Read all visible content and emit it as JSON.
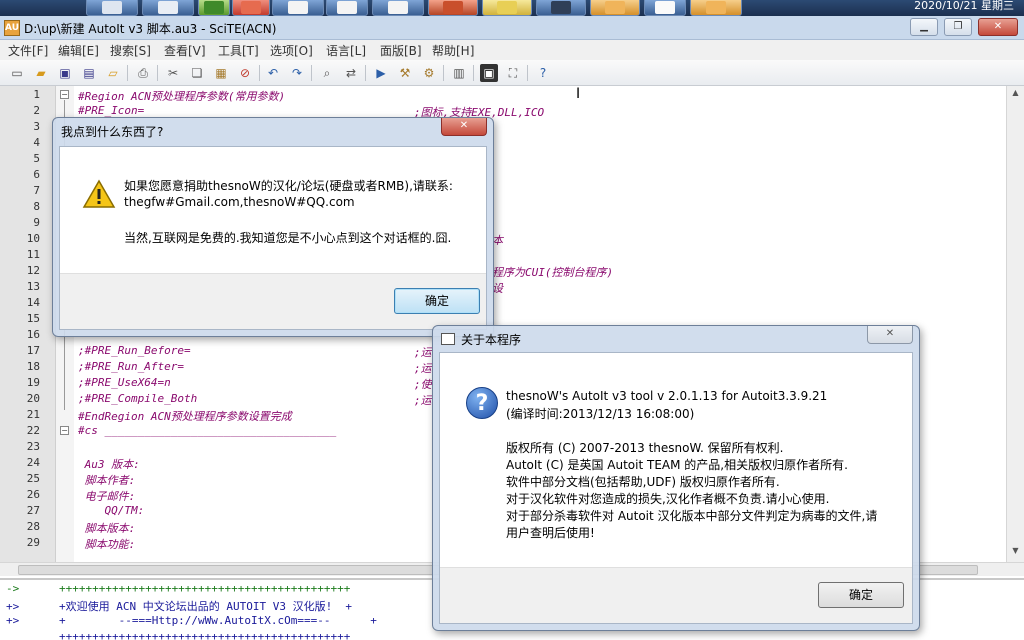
{
  "taskbar": {
    "clock_text": "2020/10/21 星期三"
  },
  "window": {
    "title": "D:\\up\\新建 AutoIt v3 脚本.au3 - SciTE(ACN)",
    "app_icon_label": "AU",
    "minimize_icon": "minimize-icon",
    "restore_icon": "restore-icon",
    "close_icon": "close-icon"
  },
  "menu": {
    "items": [
      "文件[F]",
      "编辑[E]",
      "搜索[S]",
      "查看[V]",
      "工具[T]",
      "选项[O]",
      "语言[L]",
      "面版[B]",
      "帮助[H]"
    ]
  },
  "toolbar": {
    "icons": [
      "new-file-icon",
      "open-icon",
      "save-icon",
      "save-all-icon",
      "open-folder-icon",
      "print-icon",
      "cut-icon",
      "copy-icon",
      "paste-icon",
      "delete-icon",
      "undo-icon",
      "redo-icon",
      "find-icon",
      "replace-icon",
      "run-icon",
      "compile-icon",
      "tools-icon",
      "properties-icon",
      "fullscreen-icon",
      "window-icon",
      "help-icon"
    ]
  },
  "editor": {
    "line_numbers": [
      "1",
      "2",
      "3",
      "4",
      "5",
      "6",
      "7",
      "8",
      "9",
      "10",
      "11",
      "12",
      "13",
      "14",
      "15",
      "16",
      "17",
      "18",
      "19",
      "20",
      "21",
      "22",
      "23",
      "24",
      "25",
      "26",
      "27",
      "28",
      "29"
    ],
    "code_lines": {
      "l1": "#Region ACN预处理程序参数(常用参数)",
      "l2": "#PRE_Icon=",
      "l17": ";#PRE_Run_Before=",
      "l18": ";#PRE_Run_After=",
      "l19": ";#PRE_UseX64=n",
      "l20": ";#PRE_Compile_Both",
      "l21": "#EndRegion ACN预处理程序参数设置完成",
      "l22": "#cs ___________________________________",
      "l24": " Au3 版本:",
      "l25": " 脚本作者:",
      "l26": " 电子邮件:",
      "l27": "    QQ/TM:",
      "l28": " 脚本版本:",
      "l29": " 脚本功能:"
    },
    "comments": {
      "c2": ";图标,支持EXE,DLL,ICO",
      "c10": "本",
      "c12": "程序为CUI(控制台程序)",
      "c13": "设",
      "c17": ";运",
      "c18": ";运",
      "c19": ";使",
      "c20": ";运"
    }
  },
  "output": {
    "lines": [
      "->      ++++++++++++++++++++++++++++++++++++++++++++",
      "+>      +欢迎使用 ACN 中文论坛出品的 AUTOIT V3 汉化版!  +",
      "+>      +        --===Http://wWw.AutoItX.cOm===--      +",
      "        ++++++++++++++++++++++++++++++++++++++++++++"
    ]
  },
  "dialog_donate": {
    "title": "我点到什么东西了?",
    "close_label": "✕",
    "message_line1": "如果您愿意捐助thesnoW的汉化/论坛(硬盘或者RMB),请联系:",
    "message_line2": "thegfw#Gmail.com,thesnoW#QQ.com",
    "message_line3": "当然,互联网是免费的.我知道您是不小心点到这个对话框的.囧.",
    "ok_label": "确定"
  },
  "dialog_about": {
    "title": "关于本程序",
    "close_label": "✕",
    "product_line": "thesnoW's AutoIt v3 tool v 2.0.1.13 for Autoit3.3.9.21",
    "build_line": "(编译时间:2013/12/13  16:08:00)",
    "copyright_lines": [
      "版权所有 (C) 2007-2013 thesnoW. 保留所有权利.",
      "AutoIt (C) 是英国 Autoit TEAM 的产品,相关版权归原作者所有.",
      "软件中部分文档(包括帮助,UDF) 版权归原作者所有.",
      "对于汉化软件对您造成的损失,汉化作者概不负责.请小心使用.",
      "对于部分杀毒软件对 Autoit 汉化版本中部分文件判定为病毒的文件,请",
      "用户查明后使用!"
    ],
    "ok_label": "确定"
  }
}
